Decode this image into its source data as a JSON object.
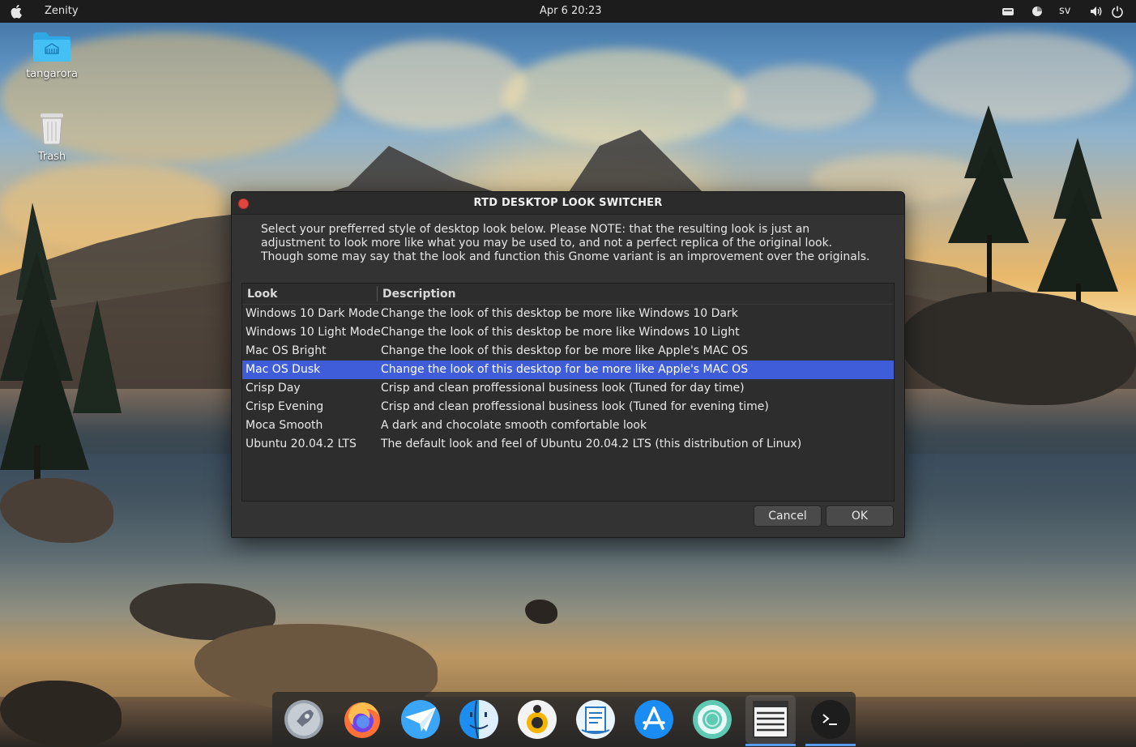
{
  "topbar": {
    "app_name": "Zenity",
    "datetime": "Apr 6  20:23",
    "lang": "sv"
  },
  "desktop": {
    "icons": [
      {
        "label": "tangarora",
        "icon": "home-folder-icon"
      },
      {
        "label": "Trash",
        "icon": "trash-icon"
      }
    ]
  },
  "dialog": {
    "title": "RTD DESKTOP LOOK SWITCHER",
    "message": "Select your prefferred style of desktop look below. Please NOTE: that the resulting look is just an\nadjustment to look more like what you may be used to, and not a perfect replica of the original look.\nThough some may say that the look and function this Gnome variant is an improvement over the originals.",
    "columns": [
      "Look",
      "Description"
    ],
    "rows": [
      {
        "look": "Windows 10 Dark Mode",
        "description": "Change the look of this desktop be more like Windows 10 Dark"
      },
      {
        "look": "Windows 10 Light Mode",
        "description": "Change the look of this desktop be more like Windows 10 Light"
      },
      {
        "look": "Mac OS Bright",
        "description": "Change the look of this desktop for be more like Apple's MAC OS"
      },
      {
        "look": "Mac OS Dusk",
        "description": "Change the look of this desktop for be more like Apple's MAC OS"
      },
      {
        "look": "Crisp Day",
        "description": "Crisp and clean proffessional business look (Tuned for day time)"
      },
      {
        "look": "Crisp Evening",
        "description": "Crisp and clean proffessional business look (Tuned for evening time)"
      },
      {
        "look": "Moca Smooth",
        "description": "A dark and chocolate smooth comfortable look"
      },
      {
        "look": "Ubuntu 20.04.2 LTS",
        "description": "The default look and feel of Ubuntu 20.04.2 LTS (this distribution of Linux)"
      }
    ],
    "selected_row": 3,
    "cancel_label": "Cancel",
    "ok_label": "OK"
  },
  "dock": {
    "items": [
      {
        "icon": "launchpad-rocket-icon"
      },
      {
        "icon": "firefox-icon"
      },
      {
        "icon": "mail-icon"
      },
      {
        "icon": "finder-icon"
      },
      {
        "icon": "music-player-icon"
      },
      {
        "icon": "text-editor-icon"
      },
      {
        "icon": "app-store-icon"
      },
      {
        "icon": "help-lifebuoy-icon"
      },
      {
        "icon": "zenity-list-icon"
      },
      {
        "icon": "terminal-icon"
      }
    ],
    "active": [
      "zenity-list-icon",
      "terminal-icon"
    ]
  },
  "colors": {
    "selection": "#3f5dd8",
    "dialog_bg": "#333333",
    "close_button": "#e0443e"
  }
}
